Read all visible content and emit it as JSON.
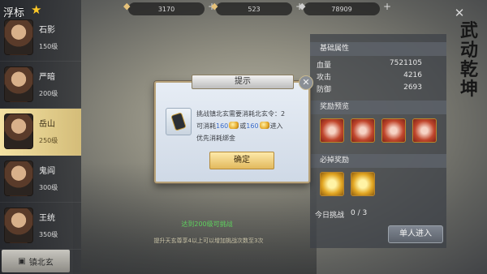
{
  "header": {
    "title": "浮标",
    "resources": [
      {
        "icon": "ingot-icon",
        "value": "3170"
      },
      {
        "icon": "gold-icon",
        "value": "523"
      },
      {
        "icon": "silver-icon",
        "value": "78909"
      }
    ]
  },
  "sidebar": {
    "items": [
      {
        "name": "石影",
        "level": "150级"
      },
      {
        "name": "严暗",
        "level": "200级"
      },
      {
        "name": "岳山",
        "level": "250级"
      },
      {
        "name": "鬼阎",
        "level": "300级"
      },
      {
        "name": "王统",
        "level": "350级"
      }
    ],
    "selected_index": 2,
    "bottom_tab": "镇北玄"
  },
  "main": {
    "unlock_text": "达到200级可挑战",
    "hint_text": "提升天玄尊享4以上可以增加挑战次数至3次"
  },
  "right_panel": {
    "base_title": "基础属性",
    "stats": [
      {
        "label": "血量",
        "value": "7521105"
      },
      {
        "label": "攻击",
        "value": "4216"
      },
      {
        "label": "防御",
        "value": "2693"
      }
    ],
    "reward_title": "奖励预览",
    "drop_title": "必掉奖励",
    "today_label": "今日挑战",
    "today_value": "0 / 3",
    "join_button": "单人进入",
    "logo": "武动乾坤"
  },
  "modal": {
    "title": "提示",
    "line1_prefix": "挑战镇北玄需要消耗北玄令：",
    "line1_count": "2",
    "line2_prefix": "可消耗",
    "line2_a": "160",
    "line2_or": "或",
    "line2_b": "160",
    "line2_suffix": "进入",
    "line3": "优先消耗绑金",
    "confirm": "确定"
  }
}
